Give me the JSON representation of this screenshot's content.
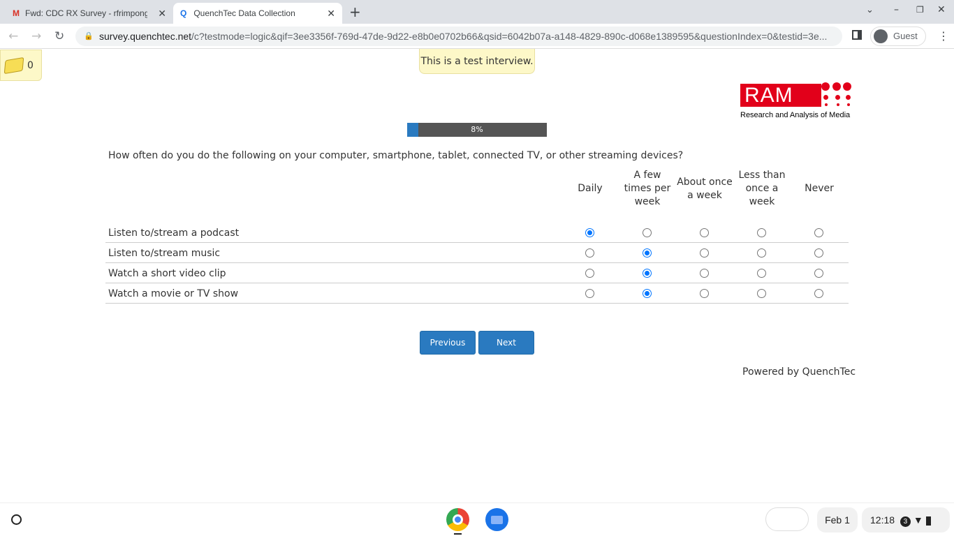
{
  "browser": {
    "tabs": [
      {
        "title": "Fwd: CDC RX Survey - rfrimpong",
        "icon": "gmail-icon"
      },
      {
        "title": "QuenchTec Data Collection",
        "icon": "quenchtec-icon"
      }
    ],
    "url_host": "survey.quenchtec.net",
    "url_path": "/c?testmode=logic&qif=3ee3356f-769d-47de-9d22-e8b0e0702b66&qsid=6042b07a-a148-4829-890c-d068e1389595&questionIndex=0&testid=3e...",
    "profile": "Guest"
  },
  "notes": {
    "count": "0"
  },
  "test_banner": "This is a test interview.",
  "logo": {
    "text": "RAM",
    "caption": "Research and Analysis of Media",
    "color": "#e2001a"
  },
  "progress": {
    "label": "8%",
    "value": 8
  },
  "question": "How often do you do the following on your computer, smartphone, tablet, connected TV, or other streaming devices?",
  "columns": [
    "Daily",
    "A few times per week",
    "About once a week",
    "Less than once a week",
    "Never"
  ],
  "rows": [
    {
      "label": "Listen to/stream a podcast",
      "selected": 0
    },
    {
      "label": "Listen to/stream music",
      "selected": 1
    },
    {
      "label": "Watch a short video clip",
      "selected": 1
    },
    {
      "label": "Watch a movie or TV show",
      "selected": 1
    }
  ],
  "buttons": {
    "previous": "Previous",
    "next": "Next"
  },
  "footer": "Powered by QuenchTec",
  "shelf": {
    "date": "Feb 1",
    "time": "12:18",
    "notifications": "3"
  }
}
